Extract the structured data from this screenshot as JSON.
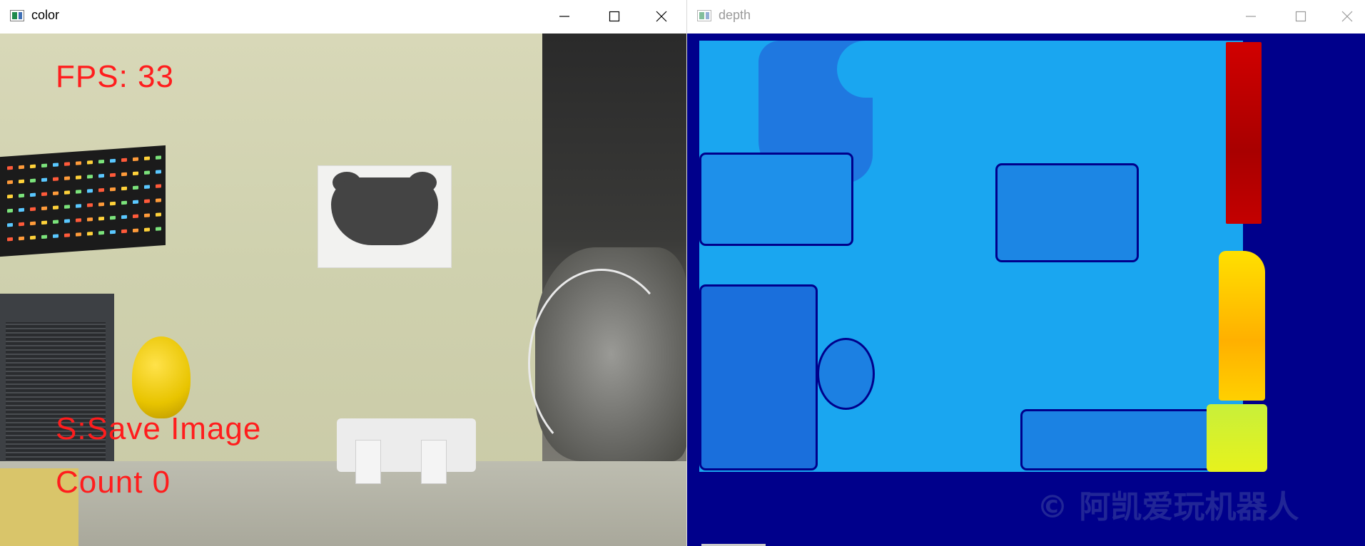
{
  "windows": [
    {
      "id": "color",
      "title": "color",
      "active": true,
      "controls": {
        "minimize": "minimize-icon",
        "maximize": "maximize-icon",
        "close": "close-icon"
      },
      "overlay": {
        "fps_text": "FPS: 33",
        "save_hint": "S:Save Image",
        "count_text": "Count 0"
      }
    },
    {
      "id": "depth",
      "title": "depth",
      "active": false,
      "controls": {
        "minimize": "minimize-icon",
        "maximize": "maximize-icon",
        "close": "close-icon"
      },
      "watermark": "© 阿凯爱玩机器人"
    }
  ],
  "colors": {
    "overlay_text": "#ff1d1d",
    "depth_background": "#00008b",
    "depth_near": "#1aa6f0",
    "depth_far_red": "#b30000",
    "depth_far_yellow": "#ffcc00"
  }
}
